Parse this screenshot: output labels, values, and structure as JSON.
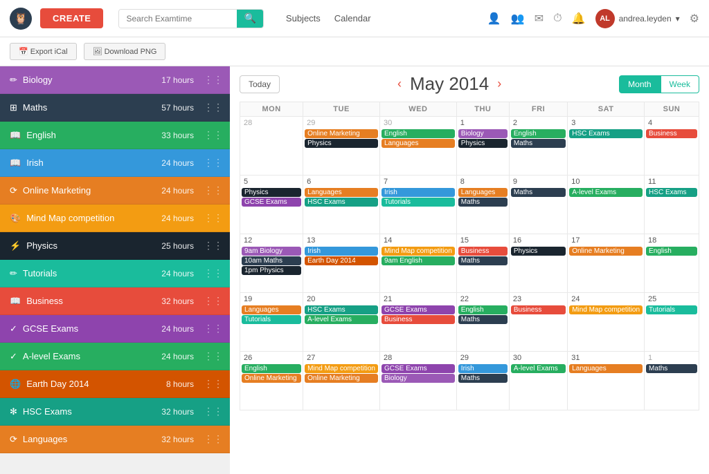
{
  "topnav": {
    "create_label": "CREATE",
    "search_placeholder": "Search Examtime",
    "nav_links": [
      "Subjects",
      "Calendar"
    ],
    "user": "andrea.leyden",
    "icons": [
      "person",
      "group",
      "mail",
      "history",
      "bell",
      "settings"
    ]
  },
  "toolbar": {
    "export_label": "Export iCal",
    "download_label": "Download PNG"
  },
  "sidebar": {
    "items": [
      {
        "id": "biology",
        "label": "Biology",
        "hours": "17 hours",
        "color": "#9b59b6",
        "icon": "✏"
      },
      {
        "id": "maths",
        "label": "Maths",
        "hours": "57 hours",
        "color": "#2c3e50",
        "icon": "⊞"
      },
      {
        "id": "english",
        "label": "English",
        "hours": "33 hours",
        "color": "#27ae60",
        "icon": "📖"
      },
      {
        "id": "irish",
        "label": "Irish",
        "hours": "24 hours",
        "color": "#3498db",
        "icon": "📖"
      },
      {
        "id": "online-marketing",
        "label": "Online Marketing",
        "hours": "24 hours",
        "color": "#e67e22",
        "icon": "⟳"
      },
      {
        "id": "mind-map",
        "label": "Mind Map competition",
        "hours": "24 hours",
        "color": "#f39c12",
        "icon": "🎨"
      },
      {
        "id": "physics",
        "label": "Physics",
        "hours": "25 hours",
        "color": "#1a252f",
        "icon": "⚡"
      },
      {
        "id": "tutorials",
        "label": "Tutorials",
        "hours": "24 hours",
        "color": "#1abc9c",
        "icon": "✏"
      },
      {
        "id": "business",
        "label": "Business",
        "hours": "32 hours",
        "color": "#e74c3c",
        "icon": "📖"
      },
      {
        "id": "gcse",
        "label": "GCSE Exams",
        "hours": "24 hours",
        "color": "#8e44ad",
        "icon": "✓"
      },
      {
        "id": "alevel",
        "label": "A-level Exams",
        "hours": "24 hours",
        "color": "#27ae60",
        "icon": "✓"
      },
      {
        "id": "earthday",
        "label": "Earth Day 2014",
        "hours": "8 hours",
        "color": "#d35400",
        "icon": "🌐"
      },
      {
        "id": "hsc",
        "label": "HSC Exams",
        "hours": "32 hours",
        "color": "#16a085",
        "icon": "✻"
      },
      {
        "id": "languages",
        "label": "Languages",
        "hours": "32 hours",
        "color": "#e67e22",
        "icon": "⟳"
      }
    ]
  },
  "calendar": {
    "title": "May 2014",
    "today_label": "Today",
    "month_label": "Month",
    "week_label": "Week",
    "days": [
      "MON",
      "TUE",
      "WED",
      "THU",
      "FRI",
      "SAT",
      "SUN"
    ],
    "weeks": [
      {
        "days": [
          {
            "num": "28",
            "current": false,
            "events": []
          },
          {
            "num": "29",
            "current": false,
            "events": [
              {
                "label": "Online Marketing",
                "color": "#e67e22"
              },
              {
                "label": "Physics",
                "color": "#1a252f"
              }
            ]
          },
          {
            "num": "30",
            "current": false,
            "events": [
              {
                "label": "English",
                "color": "#27ae60"
              },
              {
                "label": "Languages",
                "color": "#e67e22"
              }
            ]
          },
          {
            "num": "1",
            "current": true,
            "events": [
              {
                "label": "Biology",
                "color": "#9b59b6"
              },
              {
                "label": "Physics",
                "color": "#1a252f"
              }
            ]
          },
          {
            "num": "2",
            "current": true,
            "events": [
              {
                "label": "English",
                "color": "#27ae60"
              },
              {
                "label": "Maths",
                "color": "#2c3e50"
              }
            ]
          },
          {
            "num": "3",
            "current": true,
            "events": [
              {
                "label": "HSC Exams",
                "color": "#16a085"
              }
            ]
          },
          {
            "num": "4",
            "current": true,
            "events": [
              {
                "label": "Business",
                "color": "#e74c3c"
              }
            ]
          }
        ]
      },
      {
        "days": [
          {
            "num": "5",
            "current": true,
            "events": [
              {
                "label": "Physics",
                "color": "#1a252f"
              },
              {
                "label": "GCSE Exams",
                "color": "#8e44ad"
              }
            ]
          },
          {
            "num": "6",
            "current": true,
            "events": [
              {
                "label": "Languages",
                "color": "#e67e22"
              },
              {
                "label": "HSC Exams",
                "color": "#16a085"
              }
            ]
          },
          {
            "num": "7",
            "current": true,
            "events": [
              {
                "label": "Irish",
                "color": "#3498db"
              },
              {
                "label": "Tutorials",
                "color": "#1abc9c"
              }
            ]
          },
          {
            "num": "8",
            "current": true,
            "events": [
              {
                "label": "Languages",
                "color": "#e67e22"
              },
              {
                "label": "Maths",
                "color": "#2c3e50"
              }
            ]
          },
          {
            "num": "9",
            "current": true,
            "events": [
              {
                "label": "Maths",
                "color": "#2c3e50"
              }
            ]
          },
          {
            "num": "10",
            "current": true,
            "events": [
              {
                "label": "A-level Exams",
                "color": "#27ae60"
              }
            ]
          },
          {
            "num": "11",
            "current": true,
            "events": [
              {
                "label": "HSC Exams",
                "color": "#16a085"
              }
            ]
          }
        ]
      },
      {
        "days": [
          {
            "num": "12",
            "current": true,
            "events": [
              {
                "label": "9am Biology",
                "color": "#9b59b6"
              },
              {
                "label": "10am Maths",
                "color": "#2c3e50"
              },
              {
                "label": "1pm Physics",
                "color": "#1a252f"
              }
            ]
          },
          {
            "num": "13",
            "current": true,
            "events": [
              {
                "label": "Irish",
                "color": "#3498db"
              },
              {
                "label": "Earth Day 2014",
                "color": "#d35400"
              }
            ]
          },
          {
            "num": "14",
            "current": true,
            "events": [
              {
                "label": "Mind Map competition",
                "color": "#f39c12"
              },
              {
                "label": "9am English",
                "color": "#27ae60"
              }
            ]
          },
          {
            "num": "15",
            "current": true,
            "events": [
              {
                "label": "Business",
                "color": "#e74c3c"
              },
              {
                "label": "Maths",
                "color": "#2c3e50"
              }
            ]
          },
          {
            "num": "16",
            "current": true,
            "events": [
              {
                "label": "Physics",
                "color": "#1a252f"
              }
            ]
          },
          {
            "num": "17",
            "current": true,
            "events": [
              {
                "label": "Online Marketing",
                "color": "#e67e22"
              }
            ]
          },
          {
            "num": "18",
            "current": true,
            "events": [
              {
                "label": "English",
                "color": "#27ae60"
              }
            ]
          }
        ]
      },
      {
        "days": [
          {
            "num": "19",
            "current": true,
            "events": [
              {
                "label": "Languages",
                "color": "#e67e22"
              },
              {
                "label": "Tutorials",
                "color": "#1abc9c"
              }
            ]
          },
          {
            "num": "20",
            "current": true,
            "events": [
              {
                "label": "HSC Exams",
                "color": "#16a085"
              },
              {
                "label": "A-level Exams",
                "color": "#27ae60"
              }
            ]
          },
          {
            "num": "21",
            "current": true,
            "events": [
              {
                "label": "GCSE Exams",
                "color": "#8e44ad"
              },
              {
                "label": "Business",
                "color": "#e74c3c"
              }
            ]
          },
          {
            "num": "22",
            "current": true,
            "events": [
              {
                "label": "English",
                "color": "#27ae60"
              },
              {
                "label": "Maths",
                "color": "#2c3e50"
              }
            ]
          },
          {
            "num": "23",
            "current": true,
            "events": [
              {
                "label": "Business",
                "color": "#e74c3c"
              }
            ]
          },
          {
            "num": "24",
            "current": true,
            "events": [
              {
                "label": "Mind Map competition",
                "color": "#f39c12"
              }
            ]
          },
          {
            "num": "25",
            "current": true,
            "events": [
              {
                "label": "Tutorials",
                "color": "#1abc9c"
              }
            ]
          }
        ]
      },
      {
        "days": [
          {
            "num": "26",
            "current": true,
            "events": [
              {
                "label": "English",
                "color": "#27ae60"
              },
              {
                "label": "Online Marketing",
                "color": "#e67e22"
              }
            ]
          },
          {
            "num": "27",
            "current": true,
            "events": [
              {
                "label": "Mind Map competition",
                "color": "#f39c12"
              },
              {
                "label": "Online Marketing",
                "color": "#e67e22"
              }
            ]
          },
          {
            "num": "28",
            "current": true,
            "events": [
              {
                "label": "GCSE Exams",
                "color": "#8e44ad"
              },
              {
                "label": "Biology",
                "color": "#9b59b6"
              }
            ]
          },
          {
            "num": "29",
            "current": true,
            "events": [
              {
                "label": "Irish",
                "color": "#3498db"
              },
              {
                "label": "Maths",
                "color": "#2c3e50"
              }
            ]
          },
          {
            "num": "30",
            "current": true,
            "events": [
              {
                "label": "A-level Exams",
                "color": "#27ae60"
              }
            ]
          },
          {
            "num": "31",
            "current": true,
            "events": [
              {
                "label": "Languages",
                "color": "#e67e22"
              }
            ]
          },
          {
            "num": "1",
            "current": false,
            "events": [
              {
                "label": "Maths",
                "color": "#2c3e50"
              }
            ]
          }
        ]
      }
    ]
  }
}
